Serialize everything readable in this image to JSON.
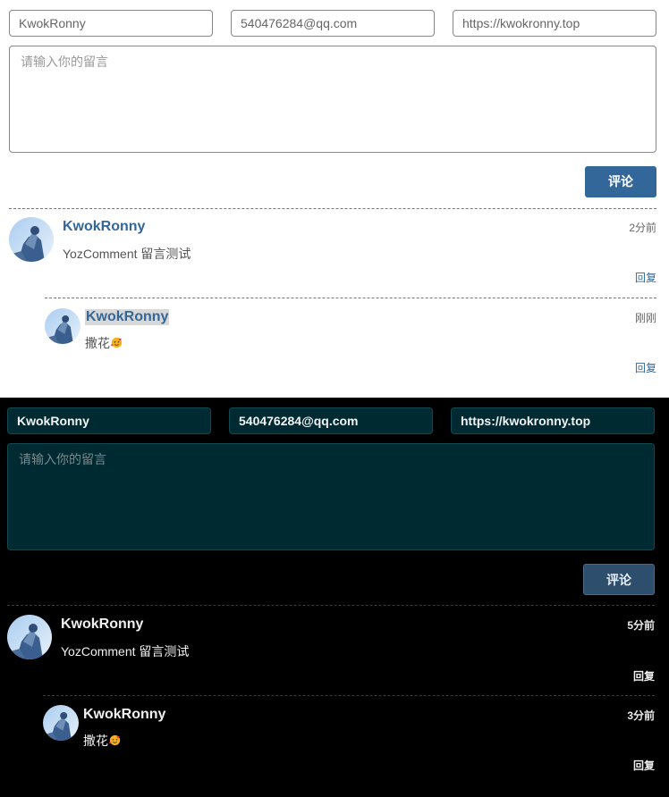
{
  "light": {
    "form": {
      "nick_value": "KwokRonny",
      "email_value": "540476284@qq.com",
      "site_value": "https://kwokronny.top",
      "message_placeholder": "请输入你的留言",
      "submit_label": "评论"
    },
    "comment": {
      "author": "KwokRonny",
      "content": "YozComment 留言测试",
      "time": "2分前",
      "reply_label": "回复"
    },
    "reply_comment": {
      "author": "KwokRonny",
      "content": "撒花",
      "time": "刚刚",
      "reply_label": "回复"
    }
  },
  "dark": {
    "form": {
      "nick_value": "KwokRonny",
      "email_value": "540476284@qq.com",
      "site_value": "https://kwokronny.top",
      "message_placeholder": "请输入你的留言",
      "submit_label": "评论"
    },
    "comment": {
      "author": "KwokRonny",
      "content": "YozComment 留言测试",
      "time": "5分前",
      "reply_label": "回复"
    },
    "reply_comment": {
      "author": "KwokRonny",
      "content": "撒花",
      "time": "3分前",
      "reply_label": "回复"
    }
  },
  "icons": {
    "avatar": "user-avatar-photo",
    "emoji": "smiling-face-with-hearts-emoji"
  },
  "colors": {
    "light_accent": "#336699",
    "dark_field_bg": "#002a31",
    "dark_button_bg": "#2d4e6c"
  }
}
